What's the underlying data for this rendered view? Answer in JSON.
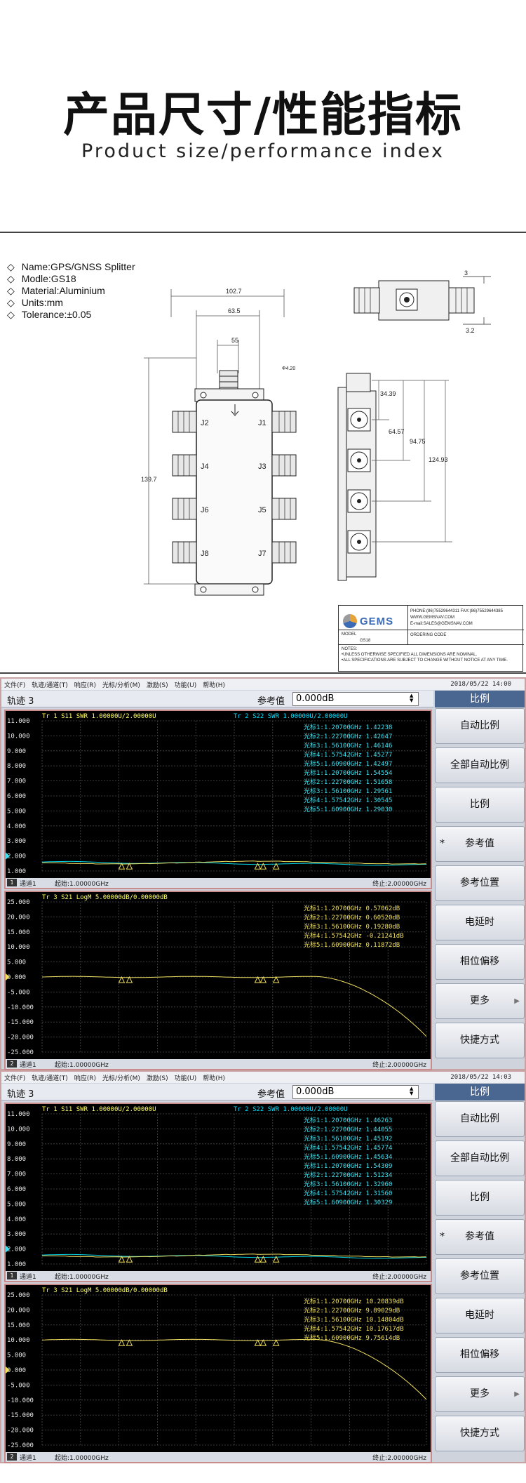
{
  "header": {
    "title": "产品尺寸/性能指标",
    "subtitle": "Product size/performance index"
  },
  "drawing": {
    "specs": [
      "Name:GPS/GNSS Splitter",
      "Modle:GS18",
      "Material:Aluminium",
      "Units:mm",
      "Tolerance:±0.05"
    ],
    "dims": {
      "overall_width": "102.7",
      "inner_width": "63.5",
      "connector_width": "55",
      "height": "139.7",
      "side_a": "34.39",
      "side_b": "64.57",
      "side_c": "94.75",
      "side_d": "124.93",
      "top_a": "3",
      "top_b": "3.2",
      "hole": "Φ4.20"
    },
    "ports": [
      "J1",
      "J2",
      "J3",
      "J4",
      "J5",
      "J6",
      "J7",
      "J8"
    ],
    "title_block": {
      "brand": "GEMS",
      "phone": "PHONE:(86)75529644311  FAX:(86)75529644385",
      "web": "WWW.GEMSNAV.COM",
      "email": "E-mail:SALES@GEMSNAV.COM",
      "model_label": "MODEL",
      "model_value": "GS18",
      "ordering": "ORDERING CODE",
      "notes_label": "NOTES:",
      "note1": "•UNLESS OTHERWISE SPECIFIED ALL DIMENSIONS ARE NOMINAL.",
      "note2": "•ALL SPECIFICATIONS ARE SUBJECT TO CHANGE WITHOUT NOTICE AT ANY TIME."
    }
  },
  "screens": [
    {
      "menu": [
        "文件(F)",
        "轨迹/通道(T)",
        "响应(R)",
        "光标/分析(M)",
        "激励(S)",
        "功能(U)",
        "帮助(H)"
      ],
      "datetime": "2018/05/22 14:00",
      "trace_label": "轨迹 3",
      "ref_label": "参考值",
      "ref_value": "0.000dB",
      "side_header": "比例",
      "side_buttons": [
        "自动比例",
        "全部自动比例",
        "比例",
        "参考值",
        "参考位置",
        "电延时",
        "相位偏移",
        "更多",
        "快捷方式"
      ],
      "upper": {
        "tr1": "Tr 1  S11 SWR 1.00000U/2.00000U",
        "tr2": "Tr 2  S22 SWR 1.00000U/2.00000U",
        "ylabels": [
          "11.000",
          "10.000",
          "9.000",
          "8.000",
          "7.000",
          "6.000",
          "5.000",
          "4.000",
          "3.000",
          "2.000",
          "1.000"
        ],
        "markers": [
          "光标1:1.20700GHz  1.42238",
          "光标2:1.22700GHz  1.42647",
          "光标3:1.56100GHz  1.46146",
          "光标4:1.57542GHz  1.45277",
          "光标5:1.60900GHz  1.42497",
          "光标1:1.20700GHz  1.54554",
          "光标2:1.22700GHz  1.51658",
          "光标3:1.56100GHz  1.29561",
          "光标4:1.57542GHz  1.30545",
          "光标5:1.60900GHz  1.29030"
        ],
        "foot_num": "1",
        "channel": "通道1",
        "start": "起始:1.00000GHz",
        "stop": "终止:2.00000GHz"
      },
      "lower": {
        "tr3": "Tr 3  S21 LogM 5.00000dB/0.00000dB",
        "ylabels": [
          "25.000",
          "20.000",
          "15.000",
          "10.000",
          "5.000",
          "0.000",
          "-5.000",
          "-10.000",
          "-15.000",
          "-20.000",
          "-25.000"
        ],
        "markers": [
          "光标1:1.20700GHz  0.57062dB",
          "光标2:1.22700GHz  0.60520dB",
          "光标3:1.56100GHz  0.19280dB",
          "光标4:1.57542GHz  -0.21241dB",
          "光标5:1.60900GHz  0.11872dB"
        ],
        "foot_num": "2",
        "channel": "通道1",
        "start": "起始:1.00000GHz",
        "stop": "终止:2.00000GHz"
      }
    },
    {
      "menu": [
        "文件(F)",
        "轨迹/通道(T)",
        "响应(R)",
        "光标/分析(M)",
        "激励(S)",
        "功能(U)",
        "帮助(H)"
      ],
      "datetime": "2018/05/22 14:03",
      "trace_label": "轨迹 3",
      "ref_label": "参考值",
      "ref_value": "0.000dB",
      "side_header": "比例",
      "side_buttons": [
        "自动比例",
        "全部自动比例",
        "比例",
        "参考值",
        "参考位置",
        "电延时",
        "相位偏移",
        "更多",
        "快捷方式"
      ],
      "upper": {
        "tr1": "Tr 1  S11 SWR 1.00000U/2.00000U",
        "tr2": "Tr 2  S22 SWR 1.00000U/2.00000U",
        "ylabels": [
          "11.000",
          "10.000",
          "9.000",
          "8.000",
          "7.000",
          "6.000",
          "5.000",
          "4.000",
          "3.000",
          "2.000",
          "1.000"
        ],
        "markers": [
          "光标1:1.20700GHz  1.46263",
          "光标2:1.22700GHz  1.44055",
          "光标3:1.56100GHz  1.45192",
          "光标4:1.57542GHz  1.45774",
          "光标5:1.60900GHz  1.45634",
          "光标1:1.20700GHz  1.54309",
          "光标2:1.22700GHz  1.51234",
          "光标3:1.56100GHz  1.32960",
          "光标4:1.57542GHz  1.31560",
          "光标5:1.60900GHz  1.30329"
        ],
        "foot_num": "1",
        "channel": "通道1",
        "start": "起始:1.00000GHz",
        "stop": "终止:2.00000GHz"
      },
      "lower": {
        "tr3": "Tr 3  S21 LogM 5.00000dB/0.00000dB",
        "ylabels": [
          "25.000",
          "20.000",
          "15.000",
          "10.000",
          "5.000",
          "0.000",
          "-5.000",
          "-10.000",
          "-15.000",
          "-20.000",
          "-25.000"
        ],
        "markers": [
          "光标1:1.20700GHz  10.20839dB",
          "光标2:1.22700GHz  9.89029dB",
          "光标3:1.56100GHz  10.14804dB",
          "光标4:1.57542GHz  10.17617dB",
          "光标5:1.60900GHz  9.75614dB"
        ],
        "foot_num": "2",
        "channel": "通道1",
        "start": "起始:1.00000GHz",
        "stop": "终止:2.00000GHz"
      }
    }
  ]
}
